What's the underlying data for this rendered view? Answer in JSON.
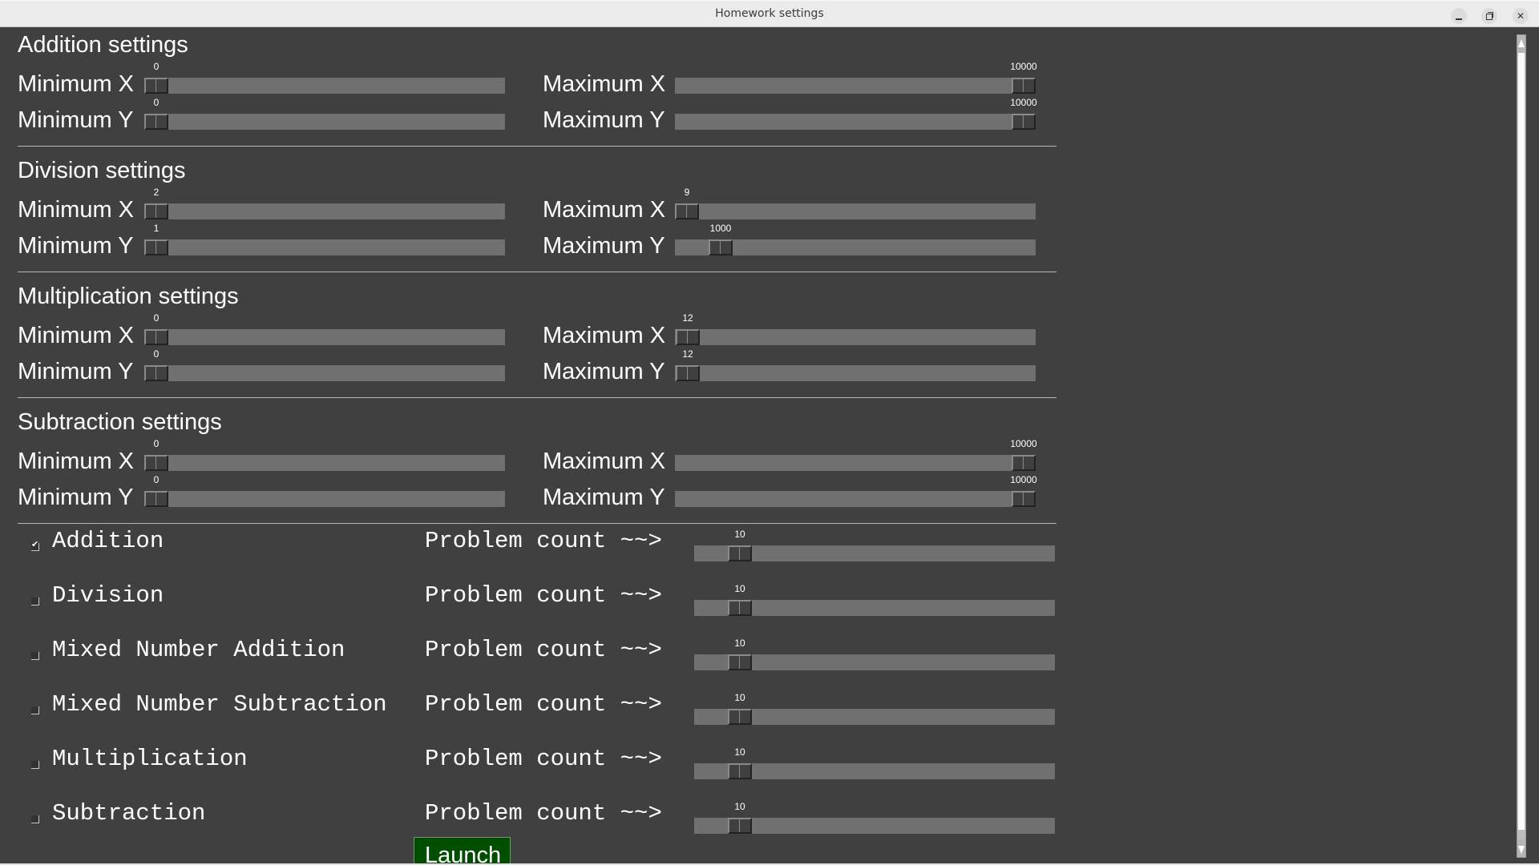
{
  "window": {
    "title": "Homework settings",
    "controls": {
      "minimize": "minimize",
      "maximize": "maximize",
      "close": "close"
    }
  },
  "sections": [
    {
      "title": "Addition settings",
      "sliders": [
        {
          "label": "Minimum X",
          "value": 0,
          "min": 0,
          "max": 10000
        },
        {
          "label": "Maximum X",
          "value": 10000,
          "min": 0,
          "max": 10000
        },
        {
          "label": "Minimum Y",
          "value": 0,
          "min": 0,
          "max": 10000
        },
        {
          "label": "Maximum Y",
          "value": 10000,
          "min": 0,
          "max": 10000
        }
      ]
    },
    {
      "title": "Division settings",
      "sliders": [
        {
          "label": "Minimum X",
          "value": 2,
          "min": 0,
          "max": 10000
        },
        {
          "label": "Maximum X",
          "value": 9,
          "min": 0,
          "max": 10000
        },
        {
          "label": "Minimum Y",
          "value": 1,
          "min": 0,
          "max": 10000
        },
        {
          "label": "Maximum Y",
          "value": 1000,
          "min": 0,
          "max": 10000
        }
      ]
    },
    {
      "title": "Multiplication settings",
      "sliders": [
        {
          "label": "Minimum X",
          "value": 0,
          "min": 0,
          "max": 10000
        },
        {
          "label": "Maximum X",
          "value": 12,
          "min": 0,
          "max": 10000
        },
        {
          "label": "Minimum Y",
          "value": 0,
          "min": 0,
          "max": 10000
        },
        {
          "label": "Maximum Y",
          "value": 12,
          "min": 0,
          "max": 10000
        }
      ]
    },
    {
      "title": "Subtraction settings",
      "sliders": [
        {
          "label": "Minimum X",
          "value": 0,
          "min": 0,
          "max": 10000
        },
        {
          "label": "Maximum X",
          "value": 10000,
          "min": 0,
          "max": 10000
        },
        {
          "label": "Minimum Y",
          "value": 0,
          "min": 0,
          "max": 10000
        },
        {
          "label": "Maximum Y",
          "value": 10000,
          "min": 0,
          "max": 10000
        }
      ]
    }
  ],
  "problems": [
    {
      "name": "Addition",
      "checked": true,
      "count_label": "Problem count ~~>",
      "count": 10,
      "min": 0,
      "max": 100
    },
    {
      "name": "Division",
      "checked": false,
      "count_label": "Problem count ~~>",
      "count": 10,
      "min": 0,
      "max": 100
    },
    {
      "name": "Mixed Number Addition",
      "checked": false,
      "count_label": "Problem count ~~>",
      "count": 10,
      "min": 0,
      "max": 100
    },
    {
      "name": "Mixed Number Subtraction",
      "checked": false,
      "count_label": "Problem count ~~>",
      "count": 10,
      "min": 0,
      "max": 100
    },
    {
      "name": "Multiplication",
      "checked": false,
      "count_label": "Problem count ~~>",
      "count": 10,
      "min": 0,
      "max": 100
    },
    {
      "name": "Subtraction",
      "checked": false,
      "count_label": "Problem count ~~>",
      "count": 10,
      "min": 0,
      "max": 100
    }
  ],
  "launch_label": "Launch",
  "colors": {
    "background": "#404040",
    "trough": "#707070",
    "launch": "#004e00"
  }
}
